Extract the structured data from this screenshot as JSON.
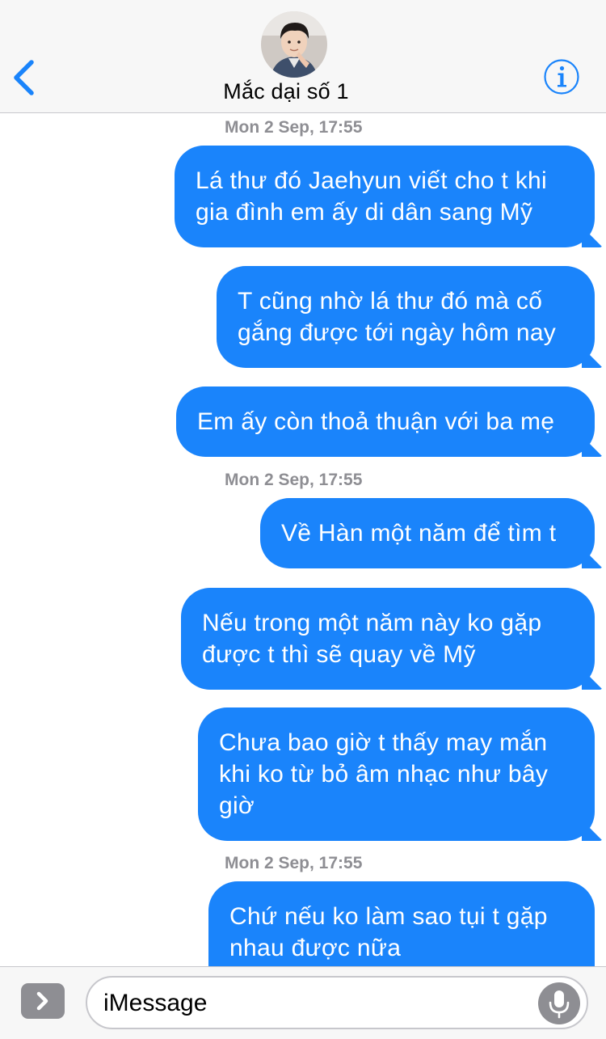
{
  "header": {
    "contact_name": "Mắc dại số 1",
    "back_icon": "chevron-left-icon",
    "info_icon": "info-icon",
    "accent_color": "#1a84fb"
  },
  "thread": {
    "timestamps": [
      "Mon 2 Sep, 17:55",
      "Mon 2 Sep, 17:55",
      "Mon 2 Sep, 17:55"
    ],
    "messages": [
      {
        "text": "Lá thư đó Jaehyun viết cho t khi gia đình em ấy di dân sang Mỹ",
        "from": "me"
      },
      {
        "text": "T cũng nhờ lá thư đó mà cố gắng được tới ngày hôm nay",
        "from": "me"
      },
      {
        "text": "Em ấy còn thoả thuận với ba mẹ",
        "from": "me"
      },
      {
        "text": "Về Hàn một năm để tìm t",
        "from": "me"
      },
      {
        "text": "Nếu trong một năm này ko gặp được t thì sẽ quay về Mỹ",
        "from": "me"
      },
      {
        "text": "Chưa bao giờ t thấy may mắn khi ko từ bỏ âm nhạc như bây giờ",
        "from": "me"
      },
      {
        "text": "Chứ nếu ko làm sao tụi t gặp nhau được nữa",
        "from": "me"
      }
    ],
    "bubble_color": "#1a84fb"
  },
  "composer": {
    "placeholder": "iMessage",
    "apps_icon": "chevron-right-icon",
    "mic_icon": "microphone-icon"
  }
}
